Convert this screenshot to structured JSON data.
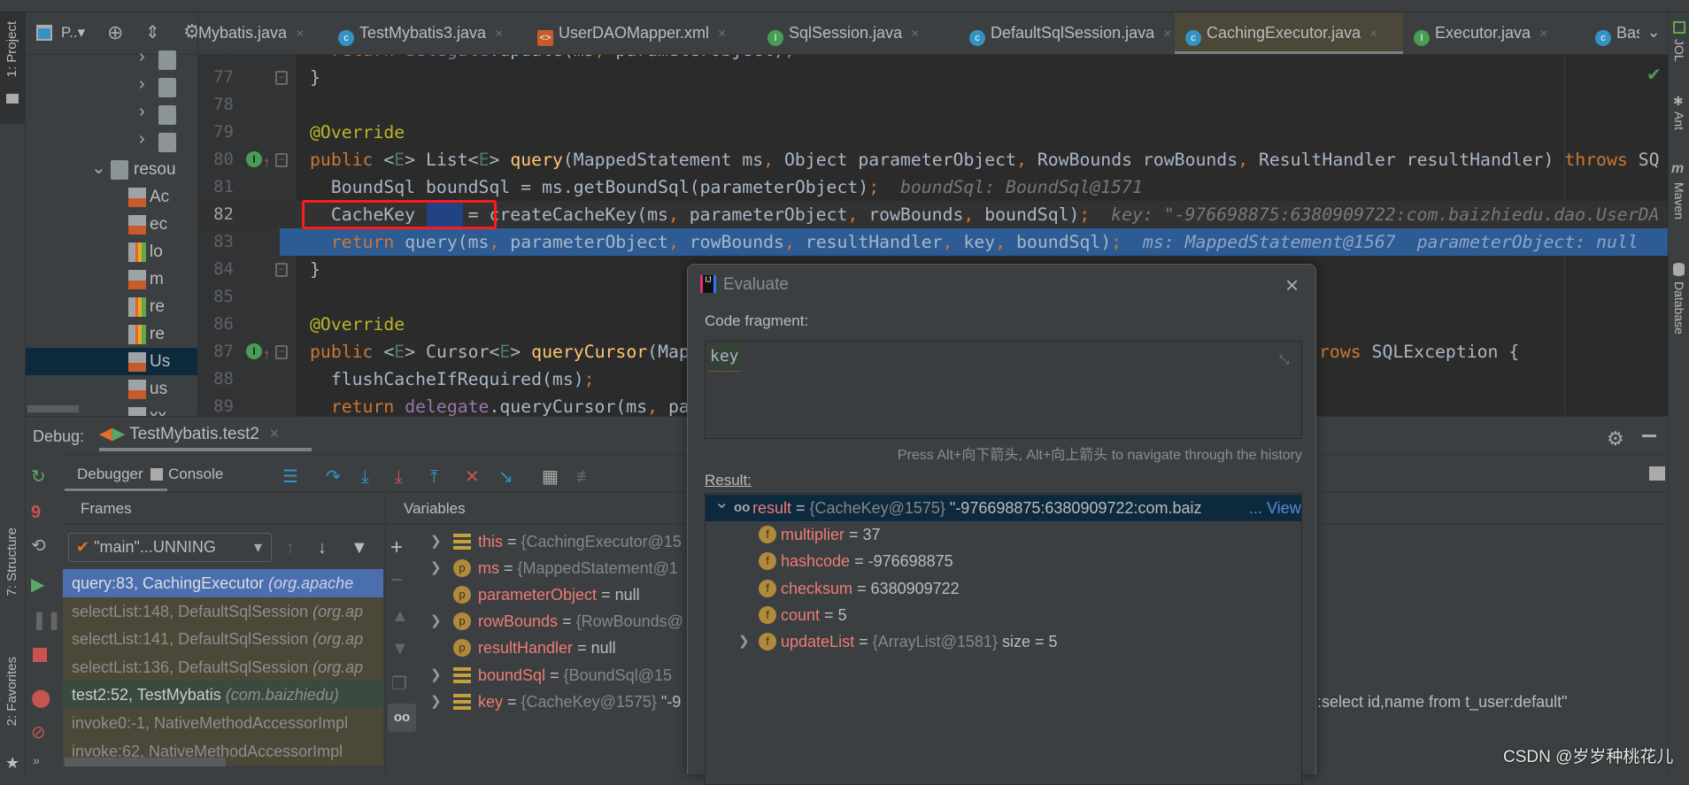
{
  "left_strip": {
    "project": "1: Project",
    "structure": "7: Structure",
    "favorites": "2: Favorites"
  },
  "right_strip": [
    "JOL",
    "Ant",
    "Maven",
    "Database"
  ],
  "project_panel": {
    "title": "P..",
    "items": [
      {
        "label": "",
        "icon": "folder",
        "chev": "›",
        "indent": 1
      },
      {
        "label": "",
        "icon": "folder",
        "chev": "›",
        "indent": 1
      },
      {
        "label": "",
        "icon": "folder",
        "chev": "›",
        "indent": 1
      },
      {
        "label": "",
        "icon": "folder",
        "chev": "›",
        "indent": 1
      },
      {
        "label": "resou",
        "icon": "resources-folder",
        "chev": "⌄",
        "indent": 0
      },
      {
        "label": "Ac",
        "icon": "xml",
        "indent": 2
      },
      {
        "label": "ec",
        "icon": "xml",
        "indent": 2
      },
      {
        "label": "lo",
        "icon": "properties",
        "indent": 2
      },
      {
        "label": "m",
        "icon": "xml",
        "indent": 2
      },
      {
        "label": "re",
        "icon": "properties",
        "indent": 2
      },
      {
        "label": "re",
        "icon": "properties",
        "indent": 2
      },
      {
        "label": "Us",
        "icon": "xml",
        "indent": 2,
        "selected": true
      },
      {
        "label": "us",
        "icon": "xml",
        "indent": 2
      },
      {
        "label": "xx",
        "icon": "xml",
        "indent": 2
      }
    ]
  },
  "tabs": [
    {
      "label": "Mybatis.java",
      "icon": "none"
    },
    {
      "label": "TestMybatis3.java",
      "icon": "class",
      "color": "#3592c4"
    },
    {
      "label": "UserDAOMapper.xml",
      "icon": "xml",
      "color": "#c75b2a"
    },
    {
      "label": "SqlSession.java",
      "icon": "interface",
      "color": "#499c54"
    },
    {
      "label": "DefaultSqlSession.java",
      "icon": "class",
      "color": "#3592c4"
    },
    {
      "label": "CachingExecutor.java",
      "icon": "class",
      "color": "#3592c4",
      "active": true
    },
    {
      "label": "Executor.java",
      "icon": "interface",
      "color": "#499c54"
    },
    {
      "label": "Bas",
      "icon": "class",
      "color": "#3592c4"
    }
  ],
  "editor": {
    "lines": [
      {
        "n": "76",
        "tokens": [
          [
            "tx",
            "  "
          ],
          [
            "kw",
            "return "
          ],
          [
            "fd",
            "delegate"
          ],
          [
            "tx",
            ".update(ms"
          ],
          [
            "pn",
            ", "
          ],
          [
            "tx",
            "parameterObject)"
          ],
          [
            "pn",
            ";"
          ]
        ]
      },
      {
        "n": "77",
        "fold": true,
        "tokens": [
          [
            "tx",
            "}"
          ]
        ]
      },
      {
        "n": "78",
        "tokens": []
      },
      {
        "n": "79",
        "tokens": [
          [
            "an",
            "@Override"
          ]
        ]
      },
      {
        "n": "80",
        "impl": true,
        "fold": true,
        "tokens": [
          [
            "kw",
            "public "
          ],
          [
            "tx",
            "<"
          ],
          [
            "tp",
            "E"
          ],
          [
            "tx",
            "> List<"
          ],
          [
            "tp",
            "E"
          ],
          [
            "tx",
            "> "
          ],
          [
            "fn",
            "query"
          ],
          [
            "tx",
            "(MappedStatement ms"
          ],
          [
            "pn",
            ", "
          ],
          [
            "tx",
            "Object parameterObject"
          ],
          [
            "pn",
            ", "
          ],
          [
            "tx",
            "RowBounds rowBounds"
          ],
          [
            "pn",
            ", "
          ],
          [
            "tx",
            "ResultHandler resultHandler) "
          ],
          [
            "kw",
            "throws "
          ],
          [
            "tx",
            "SQ"
          ]
        ]
      },
      {
        "n": "81",
        "tokens": [
          [
            "tx",
            "  BoundSql boundSql = ms.getBoundSql(parameterObject)"
          ],
          [
            "pn",
            ";"
          ],
          [
            "iv",
            "  boundSql: BoundSql@1571"
          ]
        ]
      },
      {
        "n": "82",
        "current": true,
        "tokens": [
          [
            "tx",
            "  CacheKey key = createCacheKey(ms"
          ],
          [
            "pn",
            ", "
          ],
          [
            "tx",
            "parameterObject"
          ],
          [
            "pn",
            ", "
          ],
          [
            "tx",
            "rowBounds"
          ],
          [
            "pn",
            ", "
          ],
          [
            "tx",
            "boundSql)"
          ],
          [
            "pn",
            ";"
          ],
          [
            "iv",
            "  key: \"-976698875:6380909722:com.baizhiedu.dao.UserDA"
          ]
        ]
      },
      {
        "n": "83",
        "exec": true,
        "tokens": [
          [
            "kw",
            "  return "
          ],
          [
            "tx",
            "query(ms"
          ],
          [
            "pn",
            ", "
          ],
          [
            "tx",
            "parameterObject"
          ],
          [
            "pn",
            ", "
          ],
          [
            "tx",
            "rowBounds"
          ],
          [
            "pn",
            ", "
          ],
          [
            "tx",
            "resultHandler"
          ],
          [
            "pn",
            ", "
          ],
          [
            "tx",
            "key"
          ],
          [
            "pn",
            ", "
          ],
          [
            "tx",
            "boundSql)"
          ],
          [
            "pn",
            ";"
          ],
          [
            "iv",
            "  ms: MappedStatement@1567  parameterObject: null"
          ]
        ]
      },
      {
        "n": "84",
        "fold": true,
        "tokens": [
          [
            "tx",
            "}"
          ]
        ]
      },
      {
        "n": "85",
        "tokens": []
      },
      {
        "n": "86",
        "tokens": [
          [
            "an",
            "@Override"
          ]
        ]
      },
      {
        "n": "87",
        "impl": true,
        "fold": true,
        "tokens": [
          [
            "kw",
            "public "
          ],
          [
            "tx",
            "<"
          ],
          [
            "tp",
            "E"
          ],
          [
            "tx",
            "> Cursor<"
          ],
          [
            "tp",
            "E"
          ],
          [
            "tx",
            "> "
          ],
          [
            "fn",
            "queryCursor"
          ],
          [
            "tx",
            "(Map"
          ]
        ],
        "tail": [
          [
            "kw",
            "rows "
          ],
          [
            "tx",
            "SQLException {"
          ]
        ]
      },
      {
        "n": "88",
        "tokens": [
          [
            "tx",
            "  flushCacheIfRequired(ms)"
          ],
          [
            "pn",
            ";"
          ]
        ]
      },
      {
        "n": "89",
        "tokens": [
          [
            "kw",
            "  return "
          ],
          [
            "fd",
            "delegate"
          ],
          [
            "tx",
            ".queryCursor(ms"
          ],
          [
            "pn",
            ", "
          ],
          [
            "tx",
            "pa"
          ]
        ]
      }
    ]
  },
  "debug": {
    "label": "Debug:",
    "session_tab": "TestMybatis.test2",
    "debugger_tab": "Debugger",
    "console_tab": "Console",
    "frames_header": "Frames",
    "variables_header": "Variables",
    "thread": "\"main\"...UNNING",
    "frames": [
      {
        "method": "query:83, CachingExecutor ",
        "pkg": "(org.apache",
        "kind": "sel"
      },
      {
        "method": "selectList:148, DefaultSqlSession ",
        "pkg": "(org.ap",
        "kind": "lib"
      },
      {
        "method": "selectList:141, DefaultSqlSession ",
        "pkg": "(org.ap",
        "kind": "lib"
      },
      {
        "method": "selectList:136, DefaultSqlSession ",
        "pkg": "(org.ap",
        "kind": "lib"
      },
      {
        "method": "test2:52, TestMybatis ",
        "pkg": "(com.baizhiedu)",
        "kind": "user"
      },
      {
        "method": "invoke0:-1, NativeMethodAccessorImpl",
        "pkg": "",
        "kind": "lib"
      },
      {
        "method": "invoke:62, NativeMethodAccessorImpl",
        "pkg": "",
        "kind": "lib"
      }
    ],
    "variables": [
      {
        "expand": true,
        "icon": "bars",
        "name": "this",
        "eq": " = ",
        "gray": "{CachingExecutor@15",
        "val": ""
      },
      {
        "expand": true,
        "icon": "p",
        "name": "ms",
        "eq": " = ",
        "gray": "{MappedStatement@1",
        "val": ""
      },
      {
        "expand": false,
        "icon": "p",
        "name": "parameterObject",
        "eq": " = ",
        "gray": "",
        "val": "null"
      },
      {
        "expand": true,
        "icon": "p",
        "name": "rowBounds",
        "eq": " = ",
        "gray": "{RowBounds@",
        "val": ""
      },
      {
        "expand": false,
        "icon": "p",
        "name": "resultHandler",
        "eq": " = ",
        "gray": "",
        "val": "null"
      },
      {
        "expand": true,
        "icon": "bars",
        "name": "boundSql",
        "eq": " = ",
        "gray": "{BoundSql@15",
        "val": ""
      },
      {
        "expand": true,
        "icon": "bars",
        "name": "key",
        "eq": " = ",
        "gray": "{CacheKey@1575}",
        "val": " \"-9",
        "tail": ":select id,name from t_user:default\""
      }
    ]
  },
  "evaluate": {
    "title": "Evaluate",
    "code_label": "Code fragment:",
    "code_value": "key",
    "hint": "Press Alt+向下箭头, Alt+向上箭头 to navigate through the history",
    "result_label": "Result:",
    "result": {
      "name": "result",
      "eq": " = ",
      "gray": "{CacheKey@1575}",
      "val": " \"-976698875:6380909722:com.baiz",
      "view": "... View"
    },
    "fields": [
      {
        "name": "multiplier",
        "value": "37"
      },
      {
        "name": "hashcode",
        "value": "-976698875"
      },
      {
        "name": "checksum",
        "value": "6380909722"
      },
      {
        "name": "count",
        "value": "5"
      },
      {
        "name": "updateList",
        "gray": "{ArrayList@1581}",
        "value": "  size = 5",
        "expand": true
      }
    ]
  },
  "watermark": "CSDN @岁岁种桃花儿",
  "colors": {
    "exec_line": "#2d5b94",
    "highlight_box": "#ff1a1a",
    "selected_frame": "#4b6eaf"
  }
}
